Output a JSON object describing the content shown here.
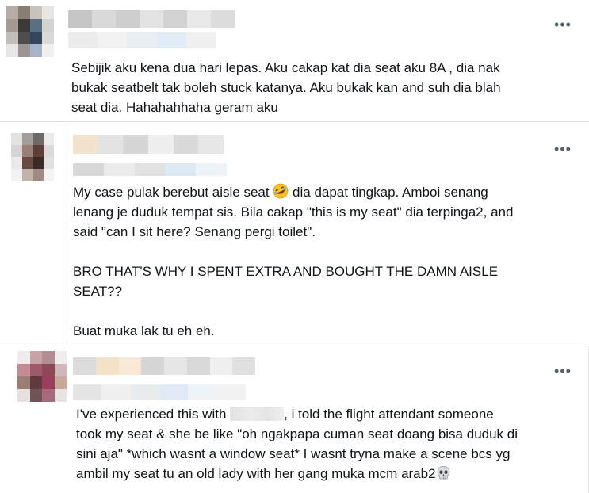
{
  "posts": [
    {
      "more_label": "•••",
      "text": "Sebijik aku kena dua hari lepas. Aku cakap kat dia seat aku 8A , dia nak\nbukak seatbelt tak boleh stuck katanya. Aku bukak kan and suh dia blah\nseat dia. Hahahahhaha geram aku"
    },
    {
      "more_label": "•••",
      "text_before_emoji": "My case pulak berebut aisle seat ",
      "emoji_name": "rolling-on-floor-laughing-emoji",
      "text_after_emoji": " dia dapat tingkap. Amboi senang\nlenang je duduk tempat sis. Bila cakap \"this is my seat\" dia terpinga2, and\nsaid \"can I sit here? Senang pergi toilet\".\n\nBRO THAT'S WHY I SPENT EXTRA AND BOUGHT THE DAMN AISLE\nSEAT??\n\nBuat muka lak tu eh eh."
    },
    {
      "more_label": "•••",
      "text_before_mention": "I've experienced this with ",
      "text_after_mention": ", i told the flight attendant someone\ntook my seat & she be like \"oh ngakpapa cuman seat doang bisa duduk di\nsini aja\" *which wasnt a window seat* I wasnt tryna make a scene bcs yg\nambil my seat tu an old lady with her gang muka mcm arab2",
      "emoji_name": "skull-emoji"
    }
  ],
  "colors": {
    "text": "#0f1419",
    "secondary": "#536471",
    "divider": "#d9dee2"
  }
}
